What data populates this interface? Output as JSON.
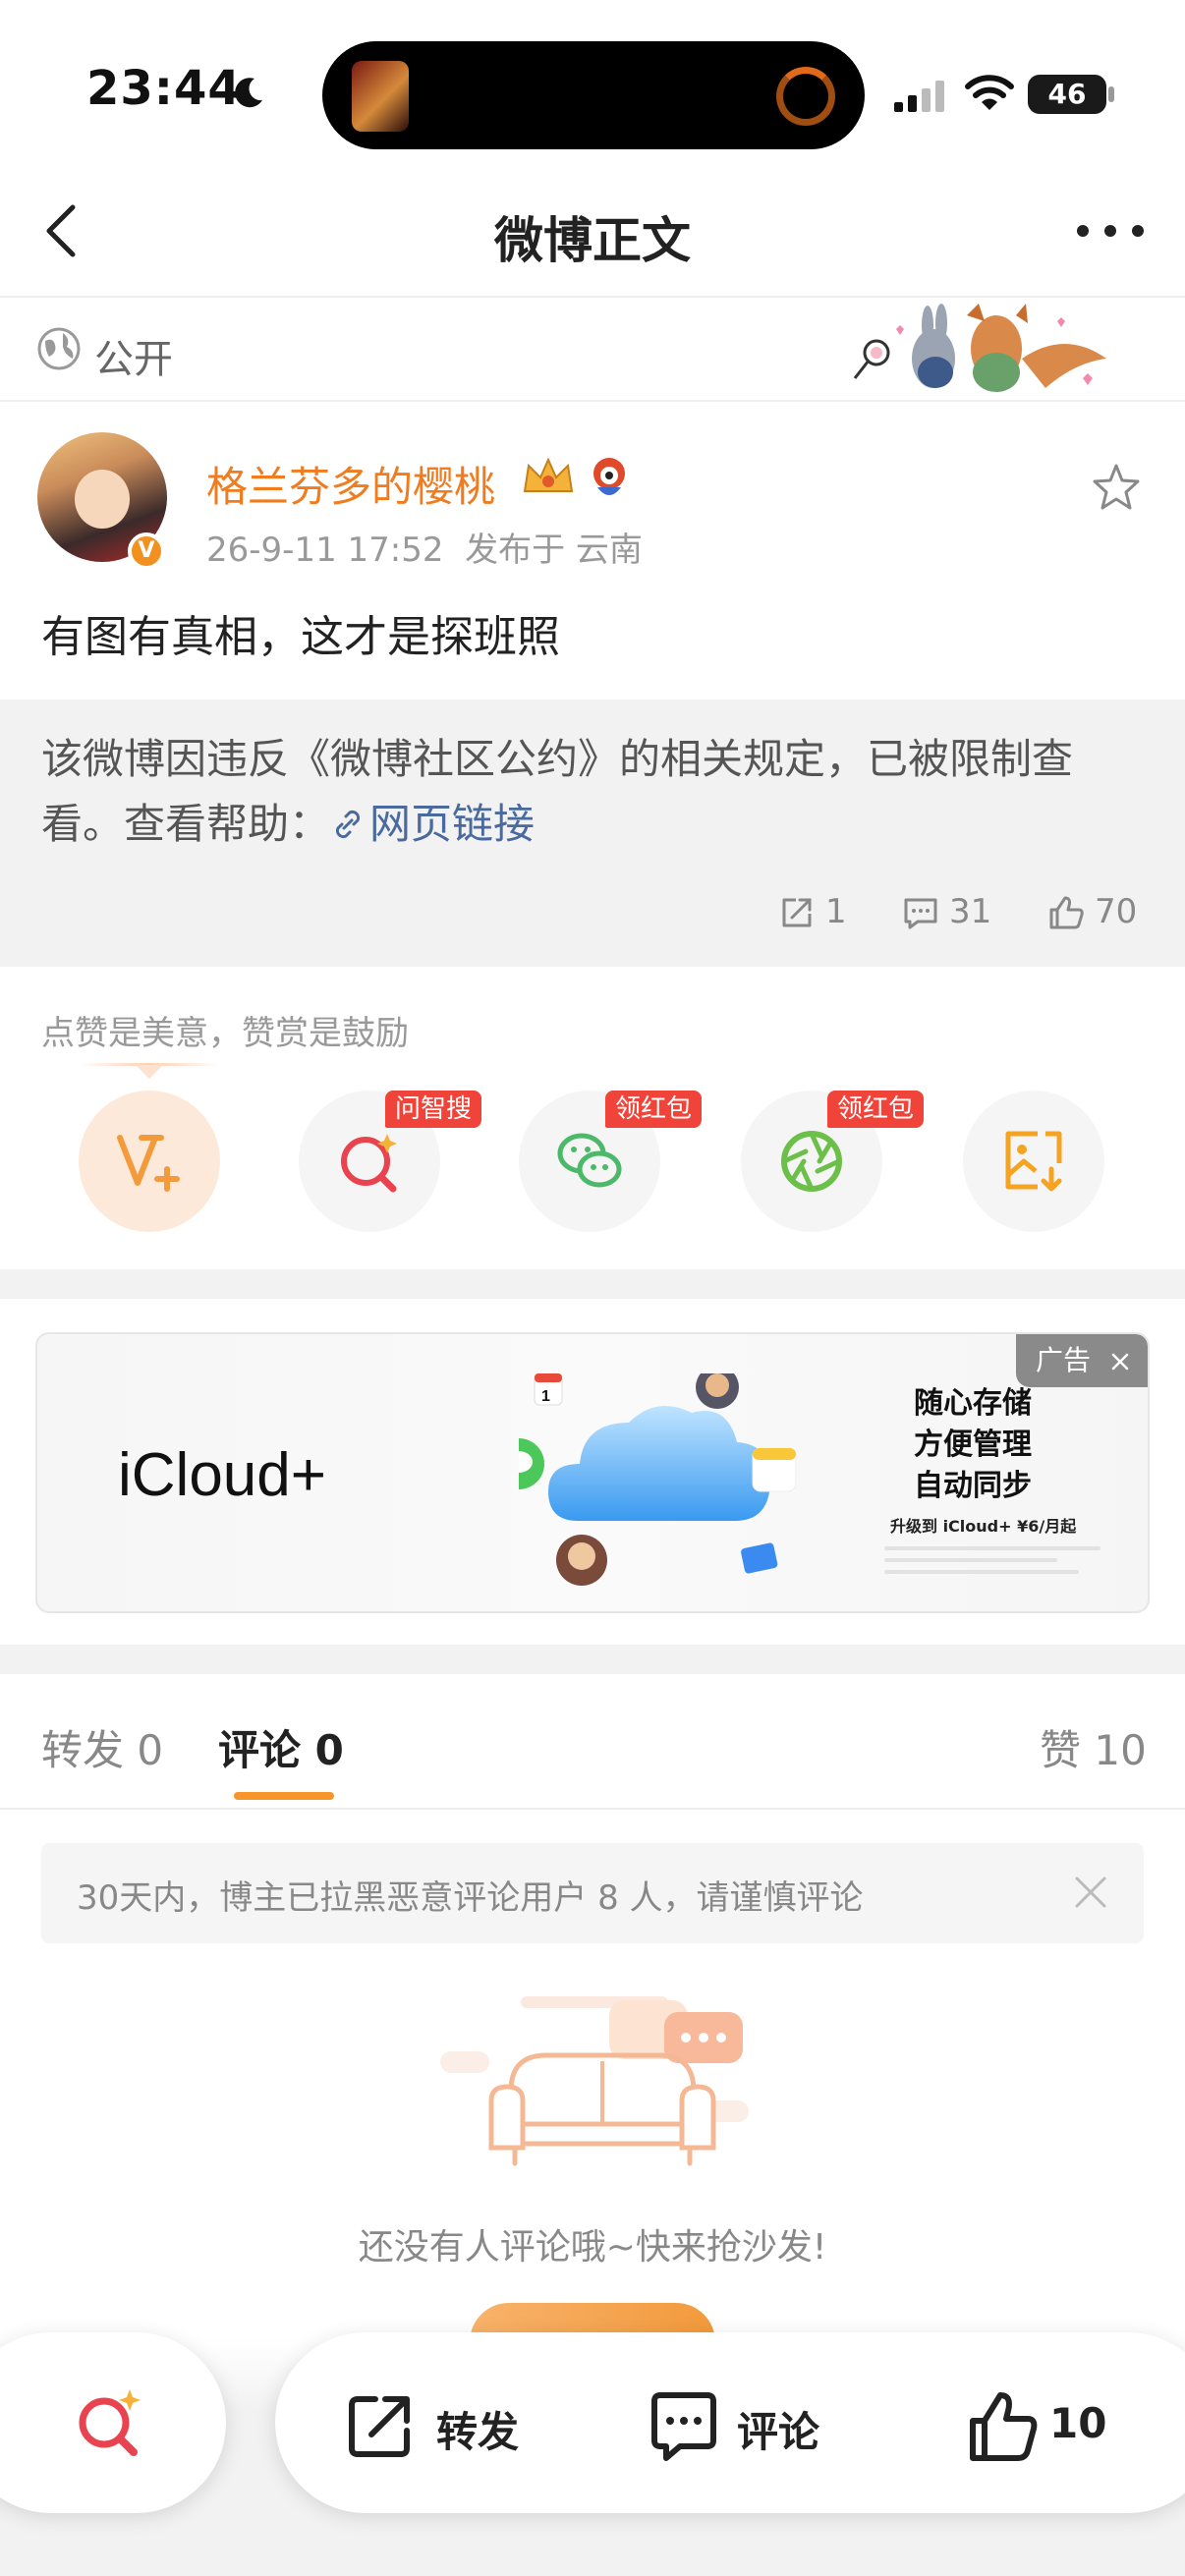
{
  "status_bar": {
    "time": "23:44",
    "battery": "46"
  },
  "nav": {
    "title": "微博正文"
  },
  "visibility": {
    "label": "公开"
  },
  "post": {
    "author": "格兰芬多的樱桃",
    "verified_badge": "V",
    "time": "26-9-11 17:52",
    "location": "发布于 云南",
    "text": "有图有真相，这才是探班照",
    "restricted_text": "该微博因违反《微博社区公约》的相关规定，已被限制查看。查看帮助：",
    "restricted_link": "网页链接",
    "stats": {
      "reposts": "1",
      "comments": "31",
      "likes": "70"
    }
  },
  "reward": {
    "tip": "点赞是美意，赞赏是鼓励",
    "buttons": [
      {
        "icon": "v-plus-icon",
        "tag": ""
      },
      {
        "icon": "ai-search-icon",
        "tag": "问智搜"
      },
      {
        "icon": "wechat-icon",
        "tag": "领红包"
      },
      {
        "icon": "aperture-icon",
        "tag": "领红包"
      },
      {
        "icon": "save-image-icon",
        "tag": ""
      }
    ]
  },
  "ad": {
    "brand": "iCloud+",
    "tag": "广告",
    "slogan": [
      "随心存储",
      "方便管理",
      "自动同步"
    ],
    "sub": "升级到 iCloud+ ¥6/月起",
    "calendar_day": "1"
  },
  "tabs": [
    {
      "label": "转发",
      "count": "0"
    },
    {
      "label": "评论",
      "count": "0"
    },
    {
      "label": "赞",
      "count": "10"
    }
  ],
  "notice": {
    "text": "30天内，博主已拉黑恶意评论用户 8 人，请谨慎评论"
  },
  "empty": {
    "text": "还没有人评论哦~快来抢沙发!"
  },
  "bottom_bar": {
    "repost": "转发",
    "comment": "评论",
    "like_count": "10"
  },
  "colors": {
    "accent": "#f07c1f",
    "link": "#4a6a9e",
    "tag_red": "#f0443a",
    "tab_indicator": "#f7952b"
  }
}
